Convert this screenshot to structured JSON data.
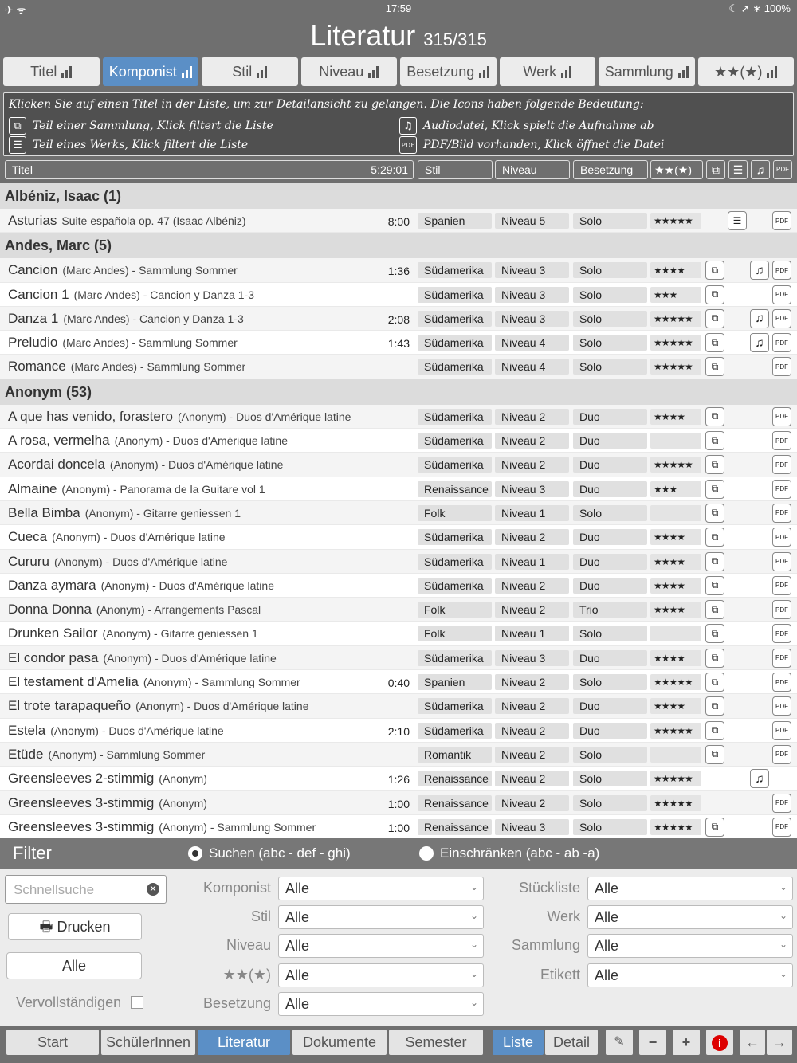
{
  "status": {
    "left": "✈ ᯤ",
    "time": "17:59",
    "right": "☾ ➚ ∗ 100%"
  },
  "title": {
    "main": "Literatur",
    "count": "315/315"
  },
  "tabs": [
    "Titel",
    "Komponist",
    "Stil",
    "Niveau",
    "Besetzung",
    "Werk",
    "Sammlung",
    "★★(★)"
  ],
  "active_tab": 1,
  "info": {
    "line1": "Klicken Sie auf einen Titel in der Liste, um zur Detailansicht zu gelangen. Die Icons haben folgende Bedeutung:",
    "l2": "Teil einer Sammlung, Klick filtert die Liste",
    "l3": "Teil eines Werks, Klick filtert die Liste",
    "r2": "Audiodatei, Klick spielt die Aufnahme ab",
    "r3": "PDF/Bild vorhanden, Klick öffnet die Datei"
  },
  "header": {
    "titel": "Titel",
    "dur": "5:29:01",
    "stil": "Stil",
    "niveau": "Niveau",
    "besetzung": "Besetzung",
    "stars": "★★(★)"
  },
  "sections": [
    {
      "name": "Albéniz, Isaac (1)",
      "rows": [
        {
          "t": "Asturias",
          "s": "Suite española op. 47 (Isaac Albéniz)",
          "d": "8:00",
          "stil": "Spanien",
          "niv": "Niveau 5",
          "bes": "Solo",
          "st": "★★★★★",
          "col": false,
          "werk": true,
          "aud": false,
          "pdf": true
        }
      ]
    },
    {
      "name": "Andes, Marc (5)",
      "rows": [
        {
          "t": "Cancion",
          "s": "(Marc Andes) - Sammlung Sommer",
          "d": "1:36",
          "stil": "Südamerika",
          "niv": "Niveau 3",
          "bes": "Solo",
          "st": "★★★★",
          "col": true,
          "werk": false,
          "aud": true,
          "pdf": true
        },
        {
          "t": "Cancion 1",
          "s": "(Marc Andes) - Cancion y Danza 1-3",
          "d": "",
          "stil": "Südamerika",
          "niv": "Niveau 3",
          "bes": "Solo",
          "st": "★★★",
          "col": true,
          "werk": false,
          "aud": false,
          "pdf": true
        },
        {
          "t": "Danza 1",
          "s": "(Marc Andes) - Cancion y Danza 1-3",
          "d": "2:08",
          "stil": "Südamerika",
          "niv": "Niveau 3",
          "bes": "Solo",
          "st": "★★★★★",
          "col": true,
          "werk": false,
          "aud": true,
          "pdf": true
        },
        {
          "t": "Preludio",
          "s": "(Marc Andes) - Sammlung Sommer",
          "d": "1:43",
          "stil": "Südamerika",
          "niv": "Niveau 4",
          "bes": "Solo",
          "st": "★★★★★",
          "col": true,
          "werk": false,
          "aud": true,
          "pdf": true
        },
        {
          "t": "Romance",
          "s": "(Marc Andes) - Sammlung Sommer",
          "d": "",
          "stil": "Südamerika",
          "niv": "Niveau 4",
          "bes": "Solo",
          "st": "★★★★★",
          "col": true,
          "werk": false,
          "aud": false,
          "pdf": true
        }
      ]
    },
    {
      "name": "Anonym (53)",
      "rows": [
        {
          "t": "A que has venido, forastero",
          "s": "(Anonym) - Duos d'Amérique latine",
          "d": "",
          "stil": "Südamerika",
          "niv": "Niveau 2",
          "bes": "Duo",
          "st": "★★★★",
          "col": true,
          "werk": false,
          "aud": false,
          "pdf": true
        },
        {
          "t": "A rosa, vermelha",
          "s": "(Anonym) - Duos d'Amérique latine",
          "d": "",
          "stil": "Südamerika",
          "niv": "Niveau 2",
          "bes": "Duo",
          "st": "",
          "col": true,
          "werk": false,
          "aud": false,
          "pdf": true
        },
        {
          "t": "Acordai doncela",
          "s": "(Anonym) - Duos d'Amérique latine",
          "d": "",
          "stil": "Südamerika",
          "niv": "Niveau 2",
          "bes": "Duo",
          "st": "★★★★★",
          "col": true,
          "werk": false,
          "aud": false,
          "pdf": true
        },
        {
          "t": "Almaine",
          "s": "(Anonym) - Panorama de la Guitare vol 1",
          "d": "",
          "stil": "Renaissance",
          "niv": "Niveau 3",
          "bes": "Duo",
          "st": "★★★",
          "col": true,
          "werk": false,
          "aud": false,
          "pdf": true
        },
        {
          "t": "Bella Bimba",
          "s": "(Anonym) - Gitarre geniessen 1",
          "d": "",
          "stil": "Folk",
          "niv": "Niveau 1",
          "bes": "Solo",
          "st": "",
          "col": true,
          "werk": false,
          "aud": false,
          "pdf": true
        },
        {
          "t": "Cueca",
          "s": "(Anonym) - Duos d'Amérique latine",
          "d": "",
          "stil": "Südamerika",
          "niv": "Niveau 2",
          "bes": "Duo",
          "st": "★★★★",
          "col": true,
          "werk": false,
          "aud": false,
          "pdf": true
        },
        {
          "t": "Cururu",
          "s": "(Anonym) - Duos d'Amérique latine",
          "d": "",
          "stil": "Südamerika",
          "niv": "Niveau 1",
          "bes": "Duo",
          "st": "★★★★",
          "col": true,
          "werk": false,
          "aud": false,
          "pdf": true
        },
        {
          "t": "Danza aymara",
          "s": "(Anonym) - Duos d'Amérique latine",
          "d": "",
          "stil": "Südamerika",
          "niv": "Niveau 2",
          "bes": "Duo",
          "st": "★★★★",
          "col": true,
          "werk": false,
          "aud": false,
          "pdf": true
        },
        {
          "t": "Donna Donna",
          "s": "(Anonym) - Arrangements Pascal",
          "d": "",
          "stil": "Folk",
          "niv": "Niveau 2",
          "bes": "Trio",
          "st": "★★★★",
          "col": true,
          "werk": false,
          "aud": false,
          "pdf": true
        },
        {
          "t": "Drunken Sailor",
          "s": "(Anonym) - Gitarre geniessen 1",
          "d": "",
          "stil": "Folk",
          "niv": "Niveau 1",
          "bes": "Solo",
          "st": "",
          "col": true,
          "werk": false,
          "aud": false,
          "pdf": true
        },
        {
          "t": "El condor pasa",
          "s": "(Anonym) - Duos d'Amérique latine",
          "d": "",
          "stil": "Südamerika",
          "niv": "Niveau 3",
          "bes": "Duo",
          "st": "★★★★",
          "col": true,
          "werk": false,
          "aud": false,
          "pdf": true
        },
        {
          "t": "El testament d'Amelia",
          "s": "(Anonym) - Sammlung Sommer",
          "d": "0:40",
          "stil": "Spanien",
          "niv": "Niveau 2",
          "bes": "Solo",
          "st": "★★★★★",
          "col": true,
          "werk": false,
          "aud": false,
          "pdf": true
        },
        {
          "t": "El trote tarapaqueño",
          "s": "(Anonym) - Duos d'Amérique latine",
          "d": "",
          "stil": "Südamerika",
          "niv": "Niveau 2",
          "bes": "Duo",
          "st": "★★★★",
          "col": true,
          "werk": false,
          "aud": false,
          "pdf": true
        },
        {
          "t": "Estela",
          "s": "(Anonym) - Duos d'Amérique latine",
          "d": "2:10",
          "stil": "Südamerika",
          "niv": "Niveau 2",
          "bes": "Duo",
          "st": "★★★★★",
          "col": true,
          "werk": false,
          "aud": false,
          "pdf": true
        },
        {
          "t": "Etüde",
          "s": "(Anonym) - Sammlung Sommer",
          "d": "",
          "stil": "Romantik",
          "niv": "Niveau 2",
          "bes": "Solo",
          "st": "",
          "col": true,
          "werk": false,
          "aud": false,
          "pdf": true
        },
        {
          "t": "Greensleeves 2-stimmig",
          "s": "(Anonym)",
          "d": "1:26",
          "stil": "Renaissance",
          "niv": "Niveau 2",
          "bes": "Solo",
          "st": "★★★★★",
          "col": false,
          "werk": false,
          "aud": true,
          "pdf": false
        },
        {
          "t": "Greensleeves 3-stimmig",
          "s": "(Anonym)",
          "d": "1:00",
          "stil": "Renaissance",
          "niv": "Niveau 2",
          "bes": "Solo",
          "st": "★★★★★",
          "col": false,
          "werk": false,
          "aud": false,
          "pdf": true
        },
        {
          "t": "Greensleeves 3-stimmig",
          "s": "(Anonym) - Sammlung Sommer",
          "d": "1:00",
          "stil": "Renaissance",
          "niv": "Niveau 3",
          "bes": "Solo",
          "st": "★★★★★",
          "col": true,
          "werk": false,
          "aud": false,
          "pdf": true
        }
      ]
    }
  ],
  "filter": {
    "title": "Filter",
    "opt1": "Suchen (abc - def - ghi)",
    "opt2": "Einschränken (abc - ab -a)",
    "search_ph": "Schnellsuche",
    "print": "Drucken",
    "all": "Alle",
    "complete": "Vervollständigen",
    "left": [
      {
        "l": "Komponist",
        "v": "Alle"
      },
      {
        "l": "Stil",
        "v": "Alle"
      },
      {
        "l": "Niveau",
        "v": "Alle"
      },
      {
        "l": "★★(★)",
        "v": "Alle"
      },
      {
        "l": "Besetzung",
        "v": "Alle"
      }
    ],
    "right": [
      {
        "l": "Stückliste",
        "v": "Alle"
      },
      {
        "l": "Werk",
        "v": "Alle"
      },
      {
        "l": "Sammlung",
        "v": "Alle"
      },
      {
        "l": "Etikett",
        "v": "Alle"
      }
    ]
  },
  "bottom": {
    "start": "Start",
    "schueler": "SchülerInnen",
    "literatur": "Literatur",
    "dokumente": "Dokumente",
    "semester": "Semester",
    "liste": "Liste",
    "detail": "Detail"
  }
}
